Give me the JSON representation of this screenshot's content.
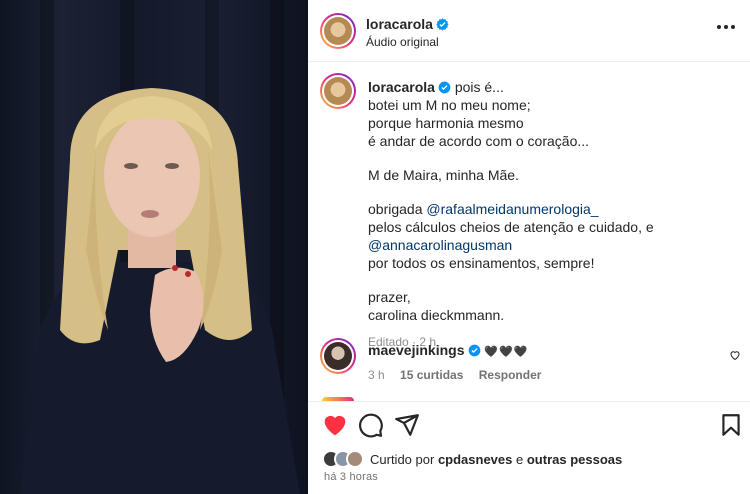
{
  "post": {
    "username": "loracarola",
    "audio_label": "Áudio original"
  },
  "caption": {
    "username": "loracarola",
    "line1": "pois é...",
    "line2": "botei um M no meu nome;",
    "line3": "porque harmonia mesmo",
    "line4": "é andar de acordo com o coração...",
    "line5": "M de Maira, minha Mãe.",
    "line6_prefix": "obrigada",
    "line6_mention": "@rafaalmeidanumerologia_",
    "line7": "pelos cálculos cheios de atenção e cuidado, e",
    "line8_mention": "@annacarolinagusman",
    "line9": "por todos os ensinamentos, sempre!",
    "line10": "prazer,",
    "line11": "carolina dieckmmann.",
    "edited_label": "Editado",
    "edited_time": "2 h"
  },
  "comment": {
    "username": "maevejinkings",
    "text": "🖤🖤🖤",
    "time": "3 h",
    "likes": "15 curtidas",
    "reply_label": "Responder"
  },
  "likes": {
    "prefix": "Curtido por",
    "user": "cpdasneves",
    "conj": "e",
    "others": "outras pessoas"
  },
  "post_time": "há 3 horas",
  "colors": {
    "like_red": "#ff3040",
    "verified_blue": "#0095f6",
    "link": "#00376b",
    "muted": "#8e8e8e"
  },
  "icons": [
    "more-options-icon",
    "verified-badge-icon",
    "heart-icon",
    "comment-icon",
    "share-icon",
    "bookmark-icon"
  ]
}
